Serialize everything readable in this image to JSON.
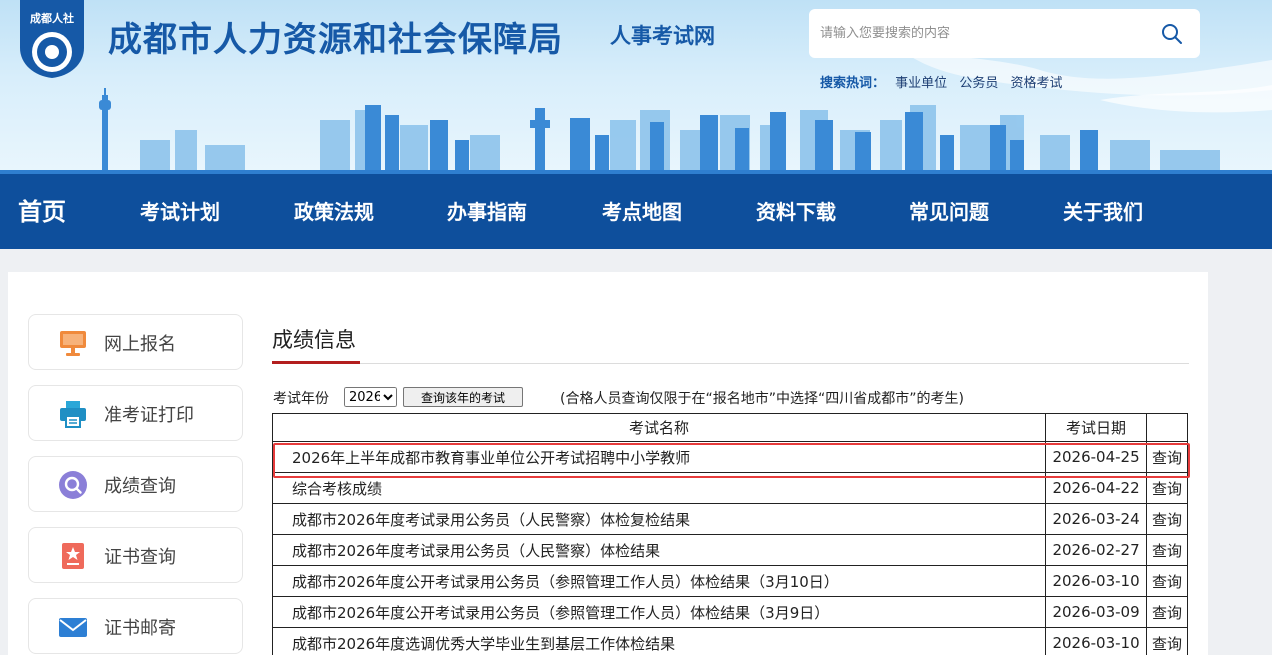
{
  "header": {
    "logo_text": "成都人社",
    "title": "成都市人力资源和社会保障局",
    "subtitle": "人事考试网",
    "search_placeholder": "请输入您要搜索的内容",
    "hot_label": "搜索热词：",
    "hot_links": [
      "事业单位",
      "公务员",
      "资格考试"
    ]
  },
  "nav": {
    "items": [
      "首页",
      "考试计划",
      "政策法规",
      "办事指南",
      "考点地图",
      "资料下载",
      "常见问题",
      "关于我们"
    ]
  },
  "sidebar": {
    "items": [
      {
        "label": "网上报名",
        "icon": "monitor-icon"
      },
      {
        "label": "准考证打印",
        "icon": "printer-icon"
      },
      {
        "label": "成绩查询",
        "icon": "search-icon"
      },
      {
        "label": "证书查询",
        "icon": "certificate-icon"
      },
      {
        "label": "证书邮寄",
        "icon": "mail-icon"
      }
    ]
  },
  "main": {
    "title": "成绩信息",
    "filter": {
      "year_label": "考试年份",
      "year_value": "2026",
      "query_button": "查询该年的考试",
      "note": "(合格人员查询仅限于在“报名地市”中选择“四川省成都市”的考生)"
    },
    "table": {
      "headers": [
        "考试名称",
        "考试日期",
        ""
      ],
      "rows": [
        {
          "name": "2026年上半年成都市教育事业单位公开考试招聘中小学教师",
          "date": "2026-04-25",
          "action": "查询"
        },
        {
          "name": "综合考核成绩",
          "date": "2026-04-22",
          "action": "查询"
        },
        {
          "name": "成都市2026年度考试录用公务员（人民警察）体检复检结果",
          "date": "2026-03-24",
          "action": "查询"
        },
        {
          "name": "成都市2026年度考试录用公务员（人民警察）体检结果",
          "date": "2026-02-27",
          "action": "查询"
        },
        {
          "name": "成都市2026年度公开考试录用公务员（参照管理工作人员）体检结果（3月10日）",
          "date": "2026-03-10",
          "action": "查询"
        },
        {
          "name": "成都市2026年度公开考试录用公务员（参照管理工作人员）体检结果（3月9日）",
          "date": "2026-03-09",
          "action": "查询"
        },
        {
          "name": "成都市2026年度选调优秀大学毕业生到基层工作体检结果",
          "date": "2026-03-10",
          "action": "查询"
        }
      ]
    }
  },
  "colors": {
    "brand_blue": "#1659a7",
    "nav_blue": "#0e4f9c",
    "highlight_red": "#e63b3b"
  }
}
